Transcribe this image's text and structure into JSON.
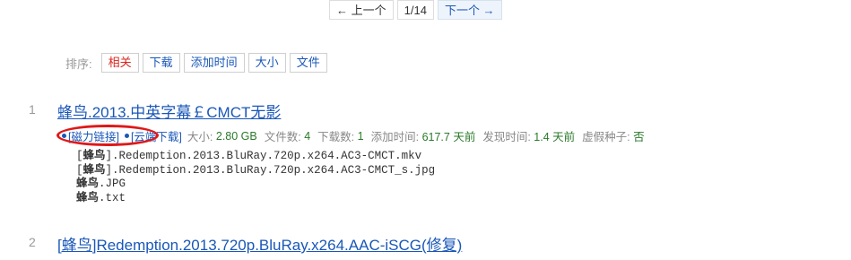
{
  "pager": {
    "prev": "← 上一个",
    "current": "1/14",
    "next": "下一个 →"
  },
  "sort": {
    "label": "排序:",
    "options": [
      "相关",
      "下载",
      "添加时间",
      "大小",
      "文件"
    ]
  },
  "results": [
    {
      "index": "1",
      "title": "蜂鸟.2013.中英字幕￡CMCT无影",
      "magnet_link": "[磁力链接]",
      "cloud_link": "[云端下载]",
      "size_label": "大小:",
      "size": "2.80 GB",
      "files_count_label": "文件数:",
      "files_count": "4",
      "downloads_label": "下载数:",
      "downloads": "1",
      "added_label": "添加时间:",
      "added": "617.7 天前",
      "found_label": "发现时间:",
      "found": "1.4 天前",
      "fake_label": "虚假种子:",
      "fake": "否",
      "files": [
        {
          "hl": "蜂鸟",
          "pre": "[",
          "post": "].Redemption.2013.BluRay.720p.x264.AC3-CMCT.mkv"
        },
        {
          "hl": "蜂鸟",
          "pre": "[",
          "post": "].Redemption.2013.BluRay.720p.x264.AC3-CMCT_s.jpg"
        },
        {
          "hl": "蜂鸟",
          "pre": "",
          "post": ".JPG"
        },
        {
          "hl": "蜂鸟",
          "pre": "",
          "post": ".txt"
        }
      ]
    },
    {
      "index": "2",
      "title": "[蜂鸟]Redemption.2013.720p.BluRay.x264.AAC-iSCG(修复)"
    }
  ],
  "colors": {
    "link": "#1a57b8",
    "active_sort": "#d8251d",
    "value_green": "#2a7a2a",
    "annotation_red": "#e01818"
  }
}
